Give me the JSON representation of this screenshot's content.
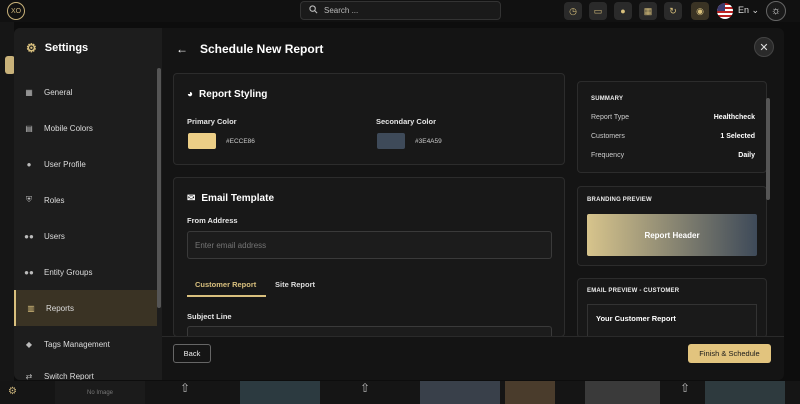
{
  "topbar": {
    "logo": "XO",
    "search_placeholder": "Search ...",
    "language": "En"
  },
  "background": {
    "no_image": "No Image"
  },
  "sidebar": {
    "title": "Settings",
    "items": [
      {
        "label": "General",
        "icon": "grid-icon"
      },
      {
        "label": "Mobile Colors",
        "icon": "palette-icon"
      },
      {
        "label": "User Profile",
        "icon": "user-icon"
      },
      {
        "label": "Roles",
        "icon": "shield-icon"
      },
      {
        "label": "Users",
        "icon": "users-icon"
      },
      {
        "label": "Entity Groups",
        "icon": "group-icon"
      },
      {
        "label": "Reports",
        "icon": "report-icon",
        "active": true
      },
      {
        "label": "Tags Management",
        "icon": "tag-icon"
      },
      {
        "label": "Switch Report",
        "icon": "switch-icon"
      }
    ]
  },
  "header": {
    "title": "Schedule New Report"
  },
  "styling": {
    "title": "Report Styling",
    "primary_label": "Primary Color",
    "primary_hex": "#ECCE86",
    "secondary_label": "Secondary Color",
    "secondary_hex": "#3E4A59"
  },
  "email": {
    "title": "Email Template",
    "from_label": "From Address",
    "from_placeholder": "Enter email address",
    "tabs": [
      "Customer Report",
      "Site Report"
    ],
    "subject_label": "Subject Line"
  },
  "summary": {
    "title": "SUMMARY",
    "rows": [
      {
        "k": "Report Type",
        "v": "Healthcheck"
      },
      {
        "k": "Customers",
        "v": "1 Selected"
      },
      {
        "k": "Frequency",
        "v": "Daily"
      }
    ]
  },
  "branding": {
    "title": "BRANDING PREVIEW",
    "header_text": "Report Header"
  },
  "email_preview": {
    "title": "EMAIL PREVIEW - CUSTOMER",
    "subject": "Your Customer Report"
  },
  "footer": {
    "back": "Back",
    "finish": "Finish & Schedule"
  },
  "colors": {
    "accent": "#D9C07E",
    "primary": "#ECCE86",
    "secondary": "#3E4A59"
  }
}
